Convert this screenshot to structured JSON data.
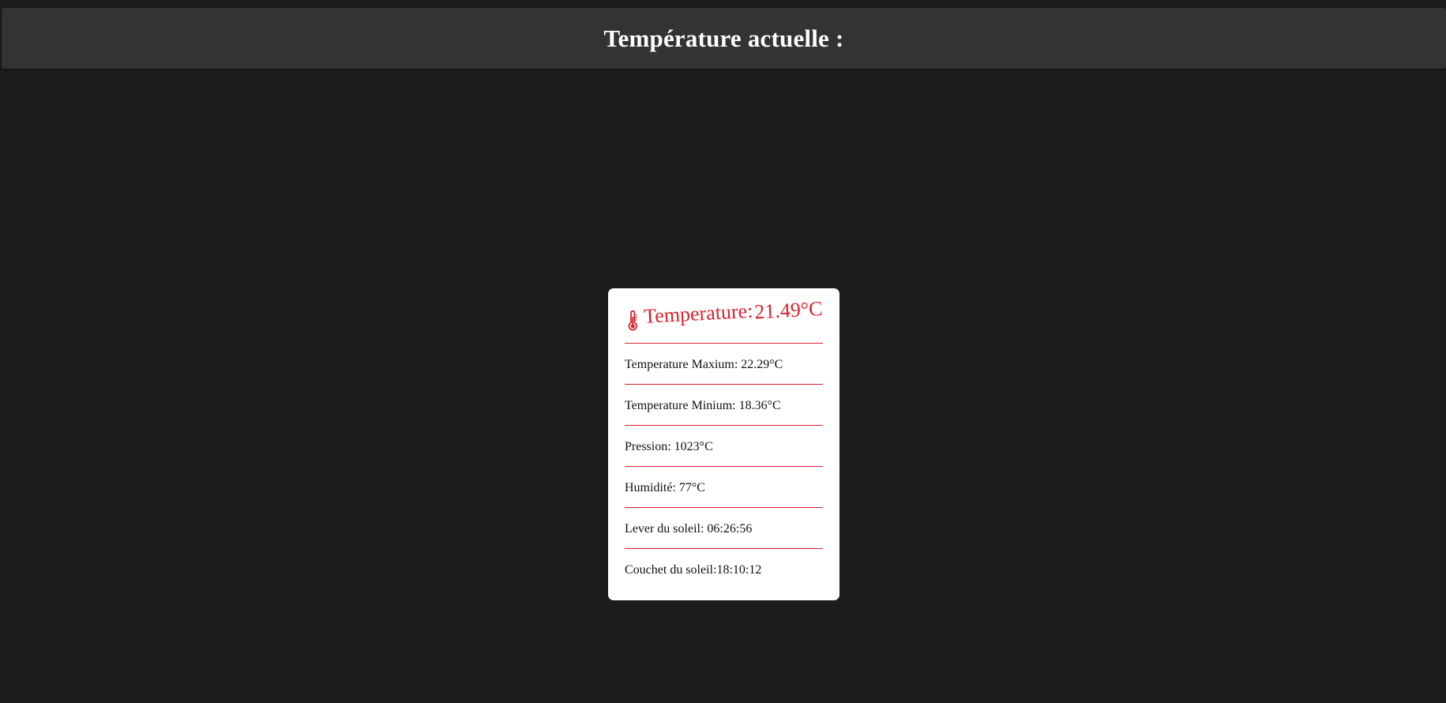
{
  "header": {
    "title": "Température actuelle :"
  },
  "card": {
    "icon": "thermometer-icon",
    "temperature_label": "Temperature:",
    "temperature_value": "21.49°C",
    "rows": [
      {
        "label": "Temperature Maxium:",
        "sep": " ",
        "value": "22.29°C"
      },
      {
        "label": "Temperature Minium:",
        "sep": " ",
        "value": "18.36°C"
      },
      {
        "label": "Pression:",
        "sep": " ",
        "value": "1023°C"
      },
      {
        "label": "Humidité:",
        "sep": " ",
        "value": "77°C"
      },
      {
        "label": "Lever du soleil:",
        "sep": " ",
        "value": "06:26:56"
      },
      {
        "label": "Couchet du soleil:",
        "sep": "",
        "value": "18:10:12"
      }
    ]
  },
  "colors": {
    "background": "#1d1c1a",
    "header_bg": "#333333",
    "accent": "#d9232e",
    "card_bg": "#ffffff"
  }
}
